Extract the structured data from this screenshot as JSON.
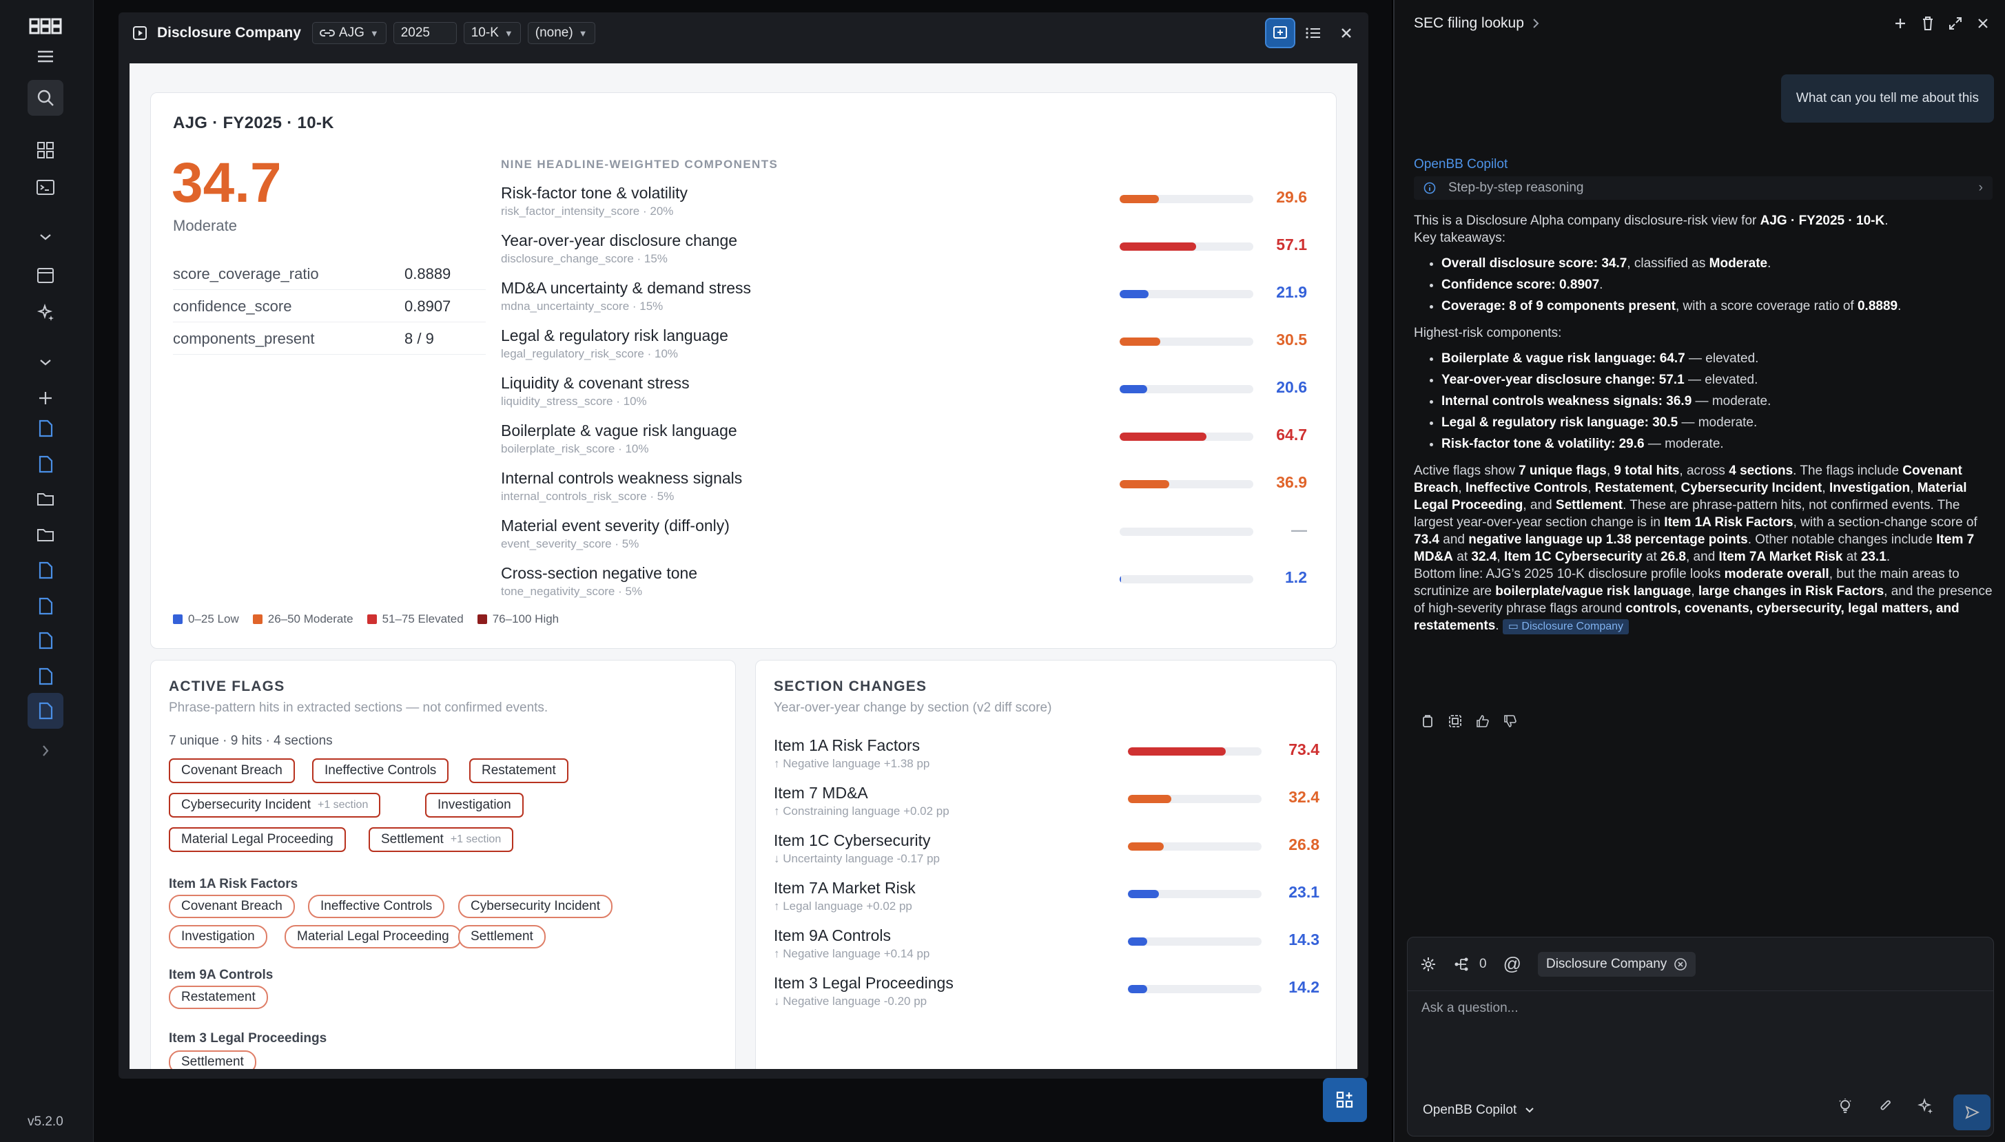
{
  "app": {
    "version": "v5.2.0"
  },
  "widget": {
    "title": "Disclosure Company",
    "ticker": "AJG",
    "year": "2025",
    "form": "10-K",
    "compare": "(none)"
  },
  "overview": {
    "heading": "AJG · FY2025 · 10-K",
    "score": "34.7",
    "score_label": "Moderate",
    "metrics": [
      {
        "key": "score_coverage_ratio",
        "value": "0.8889"
      },
      {
        "key": "confidence_score",
        "value": "0.8907"
      },
      {
        "key": "components_present",
        "value": "8 / 9"
      }
    ],
    "components_header": "NINE HEADLINE-WEIGHTED COMPONENTS",
    "components": [
      {
        "name": "Risk-factor tone & volatility",
        "sub": "risk_factor_intensity_score · 20%",
        "value": "29.6",
        "pct": 29.6,
        "band": "moderate"
      },
      {
        "name": "Year-over-year disclosure change",
        "sub": "disclosure_change_score · 15%",
        "value": "57.1",
        "pct": 57.1,
        "band": "elevated"
      },
      {
        "name": "MD&A uncertainty & demand stress",
        "sub": "mdna_uncertainty_score · 15%",
        "value": "21.9",
        "pct": 21.9,
        "band": "low"
      },
      {
        "name": "Legal & regulatory risk language",
        "sub": "legal_regulatory_risk_score · 10%",
        "value": "30.5",
        "pct": 30.5,
        "band": "moderate"
      },
      {
        "name": "Liquidity & covenant stress",
        "sub": "liquidity_stress_score · 10%",
        "value": "20.6",
        "pct": 20.6,
        "band": "low"
      },
      {
        "name": "Boilerplate & vague risk language",
        "sub": "boilerplate_risk_score · 10%",
        "value": "64.7",
        "pct": 64.7,
        "band": "elevated"
      },
      {
        "name": "Internal controls weakness signals",
        "sub": "internal_controls_risk_score · 5%",
        "value": "36.9",
        "pct": 36.9,
        "band": "moderate"
      },
      {
        "name": "Material event severity (diff-only)",
        "sub": "event_severity_score · 5%",
        "value": "—",
        "pct": 0,
        "band": "none"
      },
      {
        "name": "Cross-section negative tone",
        "sub": "tone_negativity_score · 5%",
        "value": "1.2",
        "pct": 1.2,
        "band": "low"
      }
    ],
    "legend": [
      {
        "label": "0–25 Low",
        "color": "#3461d9"
      },
      {
        "label": "26–50 Moderate",
        "color": "#e0642a"
      },
      {
        "label": "51–75 Elevated",
        "color": "#cf3131"
      },
      {
        "label": "76–100 High",
        "color": "#8e1d1d"
      }
    ]
  },
  "colors": {
    "low": "#3461d9",
    "moderate": "#e0642a",
    "elevated": "#cf3131",
    "high": "#8e1d1d",
    "none": "#aab0b9",
    "accent": "#1e5ea8"
  },
  "flags": {
    "heading": "ACTIVE FLAGS",
    "subtitle": "Phrase-pattern hits in extracted sections — not confirmed events.",
    "count": "7 unique · 9 hits · 4 sections",
    "chips": [
      {
        "label": "Covenant Breach",
        "extra": ""
      },
      {
        "label": "Ineffective Controls",
        "extra": ""
      },
      {
        "label": "Restatement",
        "extra": ""
      },
      {
        "label": "Cybersecurity Incident",
        "extra": "+1 section"
      },
      {
        "label": "Investigation",
        "extra": ""
      },
      {
        "label": "Material Legal Proceeding",
        "extra": ""
      },
      {
        "label": "Settlement",
        "extra": "+1 section"
      }
    ],
    "groups": [
      {
        "title": "Item 1A Risk Factors",
        "chips": [
          "Covenant Breach",
          "Ineffective Controls",
          "Cybersecurity Incident",
          "Investigation",
          "Material Legal Proceeding",
          "Settlement"
        ]
      },
      {
        "title": "Item 9A Controls",
        "chips": [
          "Restatement"
        ]
      },
      {
        "title": "Item 3 Legal Proceedings",
        "chips": [
          "Settlement"
        ]
      }
    ]
  },
  "sections": {
    "heading": "SECTION CHANGES",
    "subtitle": "Year-over-year change by section (v2 diff score)",
    "rows": [
      {
        "name": "Item 1A Risk Factors",
        "sub": "↑ Negative language +1.38 pp",
        "value": "73.4",
        "pct": 73.4,
        "band": "elevated"
      },
      {
        "name": "Item 7 MD&A",
        "sub": "↑ Constraining language +0.02 pp",
        "value": "32.4",
        "pct": 32.4,
        "band": "moderate"
      },
      {
        "name": "Item 1C Cybersecurity",
        "sub": "↓ Uncertainty language -0.17 pp",
        "value": "26.8",
        "pct": 26.8,
        "band": "moderate"
      },
      {
        "name": "Item 7A Market Risk",
        "sub": "↑ Legal language +0.02 pp",
        "value": "23.1",
        "pct": 23.1,
        "band": "low"
      },
      {
        "name": "Item 9A Controls",
        "sub": "↑ Negative language +0.14 pp",
        "value": "14.3",
        "pct": 14.3,
        "band": "low"
      },
      {
        "name": "Item 3 Legal Proceedings",
        "sub": "↓ Negative language -0.20 pp",
        "value": "14.2",
        "pct": 14.2,
        "band": "low"
      }
    ]
  },
  "copilot": {
    "title": "SEC filing lookup",
    "user_message": "What can you tell me about this",
    "assistant_name": "OpenBB Copilot",
    "reasoning_label": "Step-by-step reasoning",
    "intro_pre": "This is a Disclosure Alpha company disclosure-risk view for ",
    "intro_bold": "AJG · FY2025 · 10-K",
    "intro_post": ".",
    "takeaways_label": "Key takeaways:",
    "takeaways": [
      {
        "b": "Overall disclosure score: 34.7",
        "t": ", classified as ",
        "b2": "Moderate",
        "t2": "."
      },
      {
        "b": "Confidence score: 0.8907",
        "t": ".",
        "b2": "",
        "t2": ""
      },
      {
        "b": "Coverage: 8 of 9 components present",
        "t": ", with a score coverage ratio of ",
        "b2": "0.8889",
        "t2": "."
      }
    ],
    "highest_label": "Highest-risk components:",
    "highest": [
      {
        "b": "Boilerplate & vague risk language: 64.7",
        "t": " — elevated."
      },
      {
        "b": "Year-over-year disclosure change: 57.1",
        "t": " — elevated."
      },
      {
        "b": "Internal controls weakness signals: 36.9",
        "t": " — moderate."
      },
      {
        "b": "Legal & regulatory risk language: 30.5",
        "t": " — moderate."
      },
      {
        "b": "Risk-factor tone & volatility: 29.6",
        "t": " — moderate."
      }
    ],
    "para1": [
      {
        "t": "Active flags show "
      },
      {
        "b": "7 unique flags"
      },
      {
        "t": ", "
      },
      {
        "b": "9 total hits"
      },
      {
        "t": ", across "
      },
      {
        "b": "4 sections"
      },
      {
        "t": ". The flags include "
      },
      {
        "b": "Covenant Breach"
      },
      {
        "t": ", "
      },
      {
        "b": "Ineffective Controls"
      },
      {
        "t": ", "
      },
      {
        "b": "Restatement"
      },
      {
        "t": ", "
      },
      {
        "b": "Cybersecurity Incident"
      },
      {
        "t": ", "
      },
      {
        "b": "Investigation"
      },
      {
        "t": ", "
      },
      {
        "b": "Material Legal Proceeding"
      },
      {
        "t": ", and "
      },
      {
        "b": "Settlement"
      },
      {
        "t": ". These are phrase-pattern hits, not confirmed events. The largest year-over-year section change is in "
      },
      {
        "b": "Item 1A Risk Factors"
      },
      {
        "t": ", with a section-change score of "
      },
      {
        "b": "73.4"
      },
      {
        "t": " and "
      },
      {
        "b": "negative language up 1.38 percentage points"
      },
      {
        "t": ". Other notable changes include "
      },
      {
        "b": "Item 7 MD&A"
      },
      {
        "t": " at "
      },
      {
        "b": "32.4"
      },
      {
        "t": ", "
      },
      {
        "b": "Item 1C Cybersecurity"
      },
      {
        "t": " at "
      },
      {
        "b": "26.8"
      },
      {
        "t": ", and "
      },
      {
        "b": "Item 7A Market Risk"
      },
      {
        "t": " at "
      },
      {
        "b": "23.1"
      },
      {
        "t": "."
      }
    ],
    "para2": [
      {
        "t": "Bottom line: AJG’s 2025 10-K disclosure profile looks "
      },
      {
        "b": "moderate overall"
      },
      {
        "t": ", but the main areas to scrutinize are "
      },
      {
        "b": "boilerplate/vague risk language"
      },
      {
        "t": ", "
      },
      {
        "b": "large changes in Risk Factors"
      },
      {
        "t": ", and the presence of high-severity phrase flags around "
      },
      {
        "b": "controls, covenants, cybersecurity, legal matters, and restatements"
      },
      {
        "t": ". "
      }
    ],
    "source_tag": "Disclosure Company",
    "mention_count": "0",
    "context_chip": "Disclosure Company",
    "placeholder": "Ask a question...",
    "model": "OpenBB Copilot"
  }
}
